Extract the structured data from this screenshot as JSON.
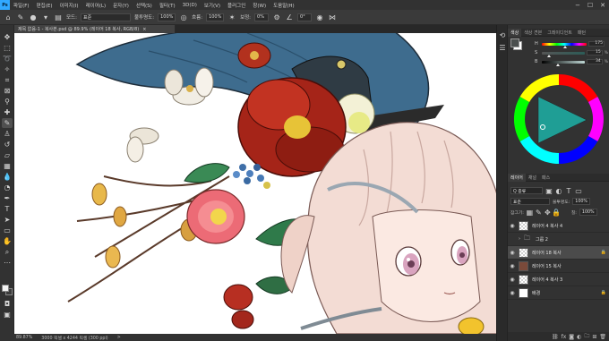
{
  "menubar": {
    "logo": "Ps",
    "items": [
      "파일(F)",
      "편집(E)",
      "이미지(I)",
      "레이어(L)",
      "문자(Y)",
      "선택(S)",
      "필터(T)",
      "3D(D)",
      "보기(V)",
      "플러그인",
      "창(W)",
      "도움말(H)"
    ],
    "controls": [
      "−",
      "☐",
      "✕"
    ]
  },
  "options": {
    "mode_label": "모드:",
    "mode_value": "표준",
    "opacity_label": "불투명도:",
    "opacity_value": "100%",
    "flow_label": "흐름:",
    "flow_value": "100%",
    "smoothing_label": "보정:",
    "smoothing_value": "0%",
    "angle_value": "0°"
  },
  "document": {
    "tab_title": "제목 없음-1 - 복사본.psd @ 89.9% (레이어 18 복사, RGB/8)",
    "tab_close": "×"
  },
  "status": {
    "zoom": "89.87%",
    "info": "3000 픽셀 x 4244 픽셀 (300 ppi)",
    "arrow": ">"
  },
  "color_panel": {
    "tabs": [
      "색상",
      "색상 견본",
      "그레이디언트",
      "패턴"
    ],
    "sliders": [
      {
        "letter": "H",
        "value": "175",
        "unit": ""
      },
      {
        "letter": "S",
        "value": "15",
        "unit": "%"
      },
      {
        "letter": "B",
        "value": "34",
        "unit": "%"
      }
    ],
    "foreground_color": "#4b4f4e",
    "background_color": "#ffffff"
  },
  "layers_panel": {
    "tabs": [
      "레이어",
      "채널",
      "패스"
    ],
    "kind_label": "Q 종류",
    "blend_mode": "표준",
    "opacity_label": "불투명도:",
    "opacity_value": "100%",
    "lock_label": "잠그기:",
    "fill_label": "칠:",
    "fill_value": "100%",
    "layers": [
      {
        "name": "레이어 4 복사 4",
        "visible": true,
        "kind": "pixel",
        "locked": false,
        "selected": false
      },
      {
        "name": "그룹 2",
        "visible": false,
        "kind": "group",
        "locked": false,
        "selected": false
      },
      {
        "name": "레이어 18 복사",
        "visible": true,
        "kind": "pixel",
        "locked": true,
        "selected": true
      },
      {
        "name": "레이어 15 복사",
        "visible": true,
        "kind": "image",
        "locked": false,
        "selected": false
      },
      {
        "name": "레이어 4 복사 3",
        "visible": true,
        "kind": "pixel",
        "locked": false,
        "selected": false
      },
      {
        "name": "배경",
        "visible": true,
        "kind": "background",
        "locked": true,
        "selected": false
      }
    ],
    "footer_icons": [
      "link-icon",
      "fx-icon",
      "mask-icon",
      "adjustment-icon",
      "folder-icon",
      "new-layer-icon",
      "trash-icon"
    ]
  },
  "colors": {
    "accent": "#31a8ff",
    "panel": "#323232",
    "canvas_bg": "#ffffff"
  }
}
